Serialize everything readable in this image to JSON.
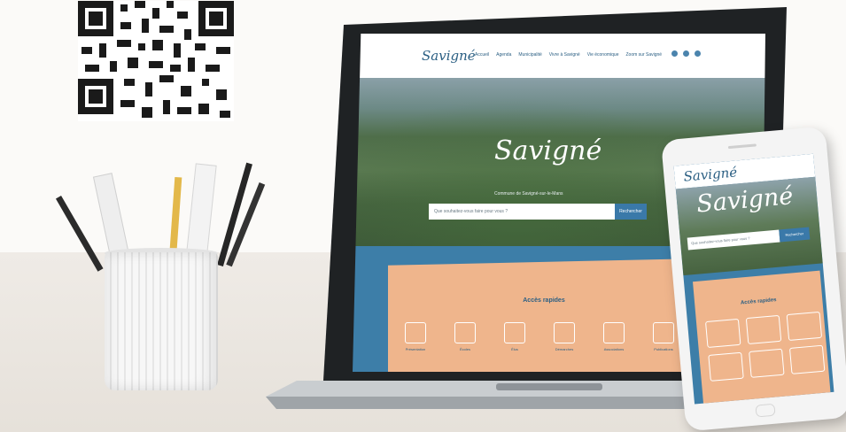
{
  "colors": {
    "brand_blue": "#2b5f83",
    "accent_blue": "#3d7ea8",
    "peach": "#efb58c",
    "desk": "#e9e4dd"
  },
  "laptop_site": {
    "logo": "Savigné",
    "nav_items": [
      "Accueil",
      "Agenda",
      "Municipalité",
      "Vivre à Savigné",
      "Vie économique",
      "Zoom sur Savigné"
    ],
    "social_icons": [
      "facebook-icon",
      "instagram-icon",
      "youtube-icon"
    ],
    "hero_title": "Savigné",
    "hero_subtitle": "Commune de Savigné-sur-le-Mans",
    "search_placeholder": "Que souhaitez-vous faire pour vous ?",
    "search_button": "Rechercher",
    "quick_access_title": "Accès rapides",
    "quick_access_items": [
      "Présentation",
      "Écoles",
      "Élus",
      "Démarches",
      "Associations",
      "Publications"
    ]
  },
  "phone_site": {
    "logo": "Savigné",
    "hero_title": "Savigné",
    "search_placeholder": "Que souhaitez-vous faire pour vous ?",
    "search_button": "Rechercher",
    "quick_access_title": "Accès rapides"
  }
}
